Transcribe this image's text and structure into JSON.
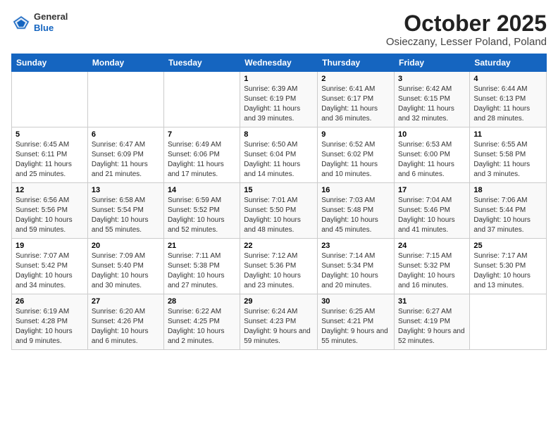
{
  "header": {
    "logo_line1": "General",
    "logo_line2": "Blue",
    "month": "October 2025",
    "location": "Osieczany, Lesser Poland, Poland"
  },
  "weekdays": [
    "Sunday",
    "Monday",
    "Tuesday",
    "Wednesday",
    "Thursday",
    "Friday",
    "Saturday"
  ],
  "weeks": [
    [
      {
        "day": "",
        "info": ""
      },
      {
        "day": "",
        "info": ""
      },
      {
        "day": "",
        "info": ""
      },
      {
        "day": "1",
        "info": "Sunrise: 6:39 AM\nSunset: 6:19 PM\nDaylight: 11 hours and 39 minutes."
      },
      {
        "day": "2",
        "info": "Sunrise: 6:41 AM\nSunset: 6:17 PM\nDaylight: 11 hours and 36 minutes."
      },
      {
        "day": "3",
        "info": "Sunrise: 6:42 AM\nSunset: 6:15 PM\nDaylight: 11 hours and 32 minutes."
      },
      {
        "day": "4",
        "info": "Sunrise: 6:44 AM\nSunset: 6:13 PM\nDaylight: 11 hours and 28 minutes."
      }
    ],
    [
      {
        "day": "5",
        "info": "Sunrise: 6:45 AM\nSunset: 6:11 PM\nDaylight: 11 hours and 25 minutes."
      },
      {
        "day": "6",
        "info": "Sunrise: 6:47 AM\nSunset: 6:09 PM\nDaylight: 11 hours and 21 minutes."
      },
      {
        "day": "7",
        "info": "Sunrise: 6:49 AM\nSunset: 6:06 PM\nDaylight: 11 hours and 17 minutes."
      },
      {
        "day": "8",
        "info": "Sunrise: 6:50 AM\nSunset: 6:04 PM\nDaylight: 11 hours and 14 minutes."
      },
      {
        "day": "9",
        "info": "Sunrise: 6:52 AM\nSunset: 6:02 PM\nDaylight: 11 hours and 10 minutes."
      },
      {
        "day": "10",
        "info": "Sunrise: 6:53 AM\nSunset: 6:00 PM\nDaylight: 11 hours and 6 minutes."
      },
      {
        "day": "11",
        "info": "Sunrise: 6:55 AM\nSunset: 5:58 PM\nDaylight: 11 hours and 3 minutes."
      }
    ],
    [
      {
        "day": "12",
        "info": "Sunrise: 6:56 AM\nSunset: 5:56 PM\nDaylight: 10 hours and 59 minutes."
      },
      {
        "day": "13",
        "info": "Sunrise: 6:58 AM\nSunset: 5:54 PM\nDaylight: 10 hours and 55 minutes."
      },
      {
        "day": "14",
        "info": "Sunrise: 6:59 AM\nSunset: 5:52 PM\nDaylight: 10 hours and 52 minutes."
      },
      {
        "day": "15",
        "info": "Sunrise: 7:01 AM\nSunset: 5:50 PM\nDaylight: 10 hours and 48 minutes."
      },
      {
        "day": "16",
        "info": "Sunrise: 7:03 AM\nSunset: 5:48 PM\nDaylight: 10 hours and 45 minutes."
      },
      {
        "day": "17",
        "info": "Sunrise: 7:04 AM\nSunset: 5:46 PM\nDaylight: 10 hours and 41 minutes."
      },
      {
        "day": "18",
        "info": "Sunrise: 7:06 AM\nSunset: 5:44 PM\nDaylight: 10 hours and 37 minutes."
      }
    ],
    [
      {
        "day": "19",
        "info": "Sunrise: 7:07 AM\nSunset: 5:42 PM\nDaylight: 10 hours and 34 minutes."
      },
      {
        "day": "20",
        "info": "Sunrise: 7:09 AM\nSunset: 5:40 PM\nDaylight: 10 hours and 30 minutes."
      },
      {
        "day": "21",
        "info": "Sunrise: 7:11 AM\nSunset: 5:38 PM\nDaylight: 10 hours and 27 minutes."
      },
      {
        "day": "22",
        "info": "Sunrise: 7:12 AM\nSunset: 5:36 PM\nDaylight: 10 hours and 23 minutes."
      },
      {
        "day": "23",
        "info": "Sunrise: 7:14 AM\nSunset: 5:34 PM\nDaylight: 10 hours and 20 minutes."
      },
      {
        "day": "24",
        "info": "Sunrise: 7:15 AM\nSunset: 5:32 PM\nDaylight: 10 hours and 16 minutes."
      },
      {
        "day": "25",
        "info": "Sunrise: 7:17 AM\nSunset: 5:30 PM\nDaylight: 10 hours and 13 minutes."
      }
    ],
    [
      {
        "day": "26",
        "info": "Sunrise: 6:19 AM\nSunset: 4:28 PM\nDaylight: 10 hours and 9 minutes."
      },
      {
        "day": "27",
        "info": "Sunrise: 6:20 AM\nSunset: 4:26 PM\nDaylight: 10 hours and 6 minutes."
      },
      {
        "day": "28",
        "info": "Sunrise: 6:22 AM\nSunset: 4:25 PM\nDaylight: 10 hours and 2 minutes."
      },
      {
        "day": "29",
        "info": "Sunrise: 6:24 AM\nSunset: 4:23 PM\nDaylight: 9 hours and 59 minutes."
      },
      {
        "day": "30",
        "info": "Sunrise: 6:25 AM\nSunset: 4:21 PM\nDaylight: 9 hours and 55 minutes."
      },
      {
        "day": "31",
        "info": "Sunrise: 6:27 AM\nSunset: 4:19 PM\nDaylight: 9 hours and 52 minutes."
      },
      {
        "day": "",
        "info": ""
      }
    ]
  ]
}
